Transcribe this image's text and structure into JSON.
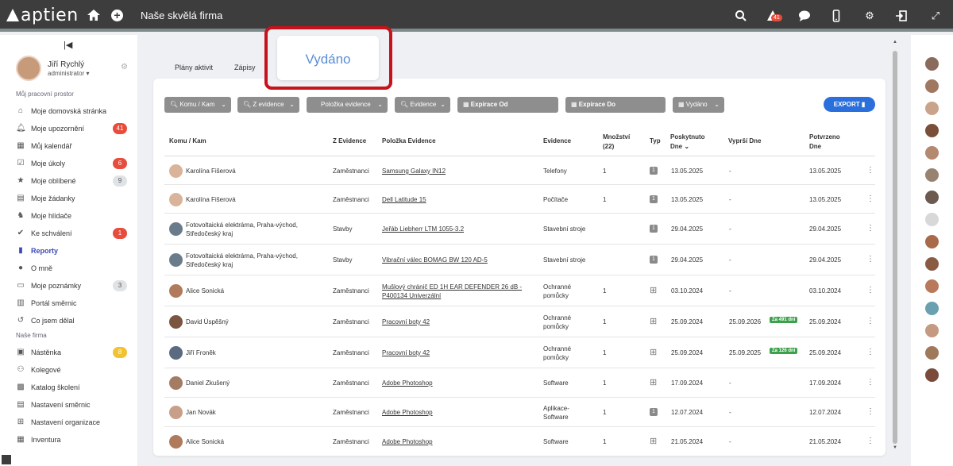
{
  "app": {
    "logo": "aptien",
    "company": "Naše skvělá firma",
    "notif_count": "41"
  },
  "user": {
    "name": "Jiří Rychlý",
    "role": "administrator"
  },
  "sidebar": {
    "section1": "Můj pracovní prostor",
    "section2": "Naše firma",
    "items": [
      {
        "label": "Moje domovská stránka",
        "icon": "home-icon"
      },
      {
        "label": "Moje upozornění",
        "icon": "bell-icon",
        "count": "41"
      },
      {
        "label": "Můj kalendář",
        "icon": "calendar-icon"
      },
      {
        "label": "Moje úkoly",
        "icon": "tasks-icon",
        "count": "6"
      },
      {
        "label": "Moje oblíbené",
        "icon": "star-icon",
        "count": "9"
      },
      {
        "label": "Moje žádanky",
        "icon": "request-icon"
      },
      {
        "label": "Moje hlídače",
        "icon": "dog-icon"
      },
      {
        "label": "Ke schválení",
        "icon": "check-icon",
        "count": "1"
      },
      {
        "label": "Reporty",
        "icon": "chart-icon"
      },
      {
        "label": "O mně",
        "icon": "person-icon"
      },
      {
        "label": "Moje poznámky",
        "icon": "note-icon",
        "count": "3"
      },
      {
        "label": "Portál směrnic",
        "icon": "book-icon"
      },
      {
        "label": "Co jsem dělal",
        "icon": "history-icon"
      },
      {
        "label": "Nástěnka",
        "icon": "board-icon",
        "count": "8"
      },
      {
        "label": "Kolegové",
        "icon": "people-icon"
      },
      {
        "label": "Katalog školení",
        "icon": "catalog-icon"
      },
      {
        "label": "Nastavení směrnic",
        "icon": "rules-icon"
      },
      {
        "label": "Nastavení organizace",
        "icon": "org-icon"
      },
      {
        "label": "Inventura",
        "icon": "inventory-icon"
      }
    ]
  },
  "tabs": [
    "Plány aktivit",
    "Zápisy",
    "Vydáno"
  ],
  "filters": [
    "Komu / Kam",
    "Z evidence",
    "Položka evidence",
    "Evidence",
    "Expirace Od",
    "Expirace Do",
    "Vydáno"
  ],
  "export_label": "EXPORT",
  "columns": {
    "komu": "Komu / Kam",
    "z_evidence": "Z Evidence",
    "polozka": "Položka Evidence",
    "evidence": "Evidence",
    "mnozstvi": "Množství",
    "mnozstvi_sum": "(22)",
    "typ": "Typ",
    "poskytnuto": "Poskytnuto",
    "poskytnuto2": "Dne",
    "vyprsi": "Vyprší Dne",
    "potvrzeno": "Potvrzeno",
    "potvrzeno2": "Dne"
  },
  "rows": [
    {
      "komu": "Karolína Fišerová",
      "z": "Zaměstnanci",
      "polozka": "Samsung Galaxy IN12",
      "evidence": "Telefony",
      "mn": "1",
      "typ": "1",
      "poskytnuto": "13.05.2025",
      "vyprsi": "-",
      "potvrzeno": "13.05.2025"
    },
    {
      "komu": "Karolína Fišerová",
      "z": "Zaměstnanci",
      "polozka": "Dell Latitude 15",
      "evidence": "Počítače",
      "mn": "1",
      "typ": "1",
      "poskytnuto": "13.05.2025",
      "vyprsi": "-",
      "potvrzeno": "13.05.2025"
    },
    {
      "komu": "Fotovoltaická elektrárna, Praha-východ,",
      "komu2": "Středočeský kraj",
      "z": "Stavby",
      "polozka": "Jeřáb Liebherr LTM 1055-3.2",
      "evidence": "Stavební stroje",
      "mn": "",
      "typ": "1",
      "poskytnuto": "29.04.2025",
      "vyprsi": "-",
      "potvrzeno": "29.04.2025"
    },
    {
      "komu": "Fotovoltaická elektrárna, Praha-východ,",
      "komu2": "Středočeský kraj",
      "z": "Stavby",
      "polozka": "Vibrační válec BOMAG BW 120 AD-5",
      "evidence": "Stavební stroje",
      "mn": "",
      "typ": "1",
      "poskytnuto": "29.04.2025",
      "vyprsi": "-",
      "potvrzeno": "29.04.2025"
    },
    {
      "komu": "Alice Sonická",
      "z": "Zaměstnanci",
      "polozka": "Mušlový chránič ED 1H EAR DEFENDER 26 dB -",
      "polozka2": "P400134 Univerzální",
      "evidence": "Ochranné",
      "evidence2": "pomůcky",
      "mn": "1",
      "typ": "+",
      "poskytnuto": "03.10.2024",
      "vyprsi": "-",
      "potvrzeno": "03.10.2024"
    },
    {
      "komu": "David Úspěšný",
      "z": "Zaměstnanci",
      "polozka": "Pracovní boty 42",
      "evidence": "Ochranné",
      "evidence2": "pomůcky",
      "mn": "1",
      "typ": "+",
      "poskytnuto": "25.09.2024",
      "vyprsi": "25.09.2026",
      "badge": "Za 491 dní",
      "potvrzeno": "25.09.2024"
    },
    {
      "komu": "Jiří Froněk",
      "z": "Zaměstnanci",
      "polozka": "Pracovní boty 42",
      "evidence": "Ochranné",
      "evidence2": "pomůcky",
      "mn": "1",
      "typ": "+",
      "poskytnuto": "25.09.2024",
      "vyprsi": "25.09.2025",
      "badge": "Za 126 dní",
      "potvrzeno": "25.09.2024"
    },
    {
      "komu": "Daniel Zkušený",
      "z": "Zaměstnanci",
      "polozka": "Adobe Photoshop",
      "evidence": "Software",
      "mn": "1",
      "typ": "+",
      "poskytnuto": "17.09.2024",
      "vyprsi": "-",
      "potvrzeno": "17.09.2024"
    },
    {
      "komu": "Jan Novák",
      "z": "Zaměstnanci",
      "polozka": "Adobe Photoshop",
      "evidence": "Aplikace-",
      "evidence2": "Software",
      "mn": "1",
      "typ": "1",
      "poskytnuto": "12.07.2024",
      "vyprsi": "-",
      "potvrzeno": "12.07.2024"
    },
    {
      "komu": "Alice Sonická",
      "z": "Zaměstnanci",
      "polozka": "Adobe Photoshop",
      "evidence": "Software",
      "mn": "1",
      "typ": "+",
      "poskytnuto": "21.05.2024",
      "vyprsi": "-",
      "potvrzeno": "21.05.2024"
    }
  ],
  "colors": {
    "accent": "#2a6fdb",
    "highlight": "#c6121a",
    "topbar": "#3d3d3d",
    "green": "#3ba24b"
  }
}
